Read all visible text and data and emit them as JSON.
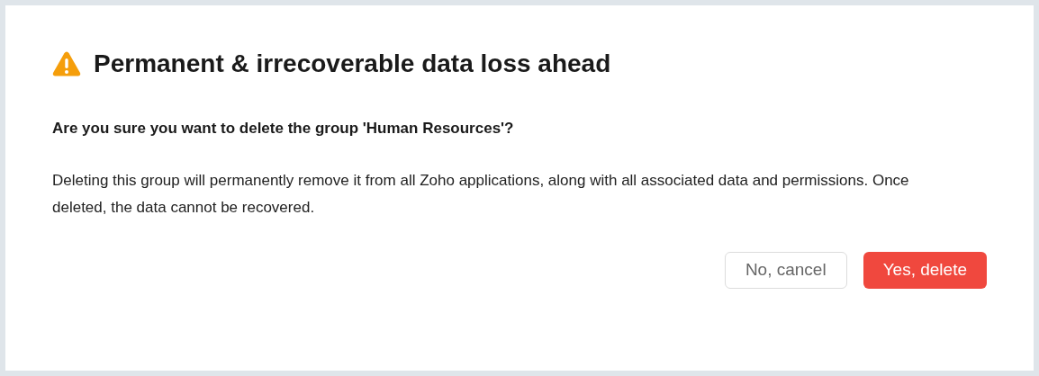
{
  "dialog": {
    "title": "Permanent & irrecoverable data loss ahead",
    "question": "Are you sure you want to delete the group 'Human Resources'?",
    "message": "Deleting this group will permanently remove it from all Zoho applications, along with all associated data and permissions. Once deleted, the data cannot be recovered.",
    "buttons": [
      {
        "label": "No, cancel",
        "kind": "secondary"
      },
      {
        "label": "Yes, delete",
        "kind": "danger"
      }
    ]
  }
}
